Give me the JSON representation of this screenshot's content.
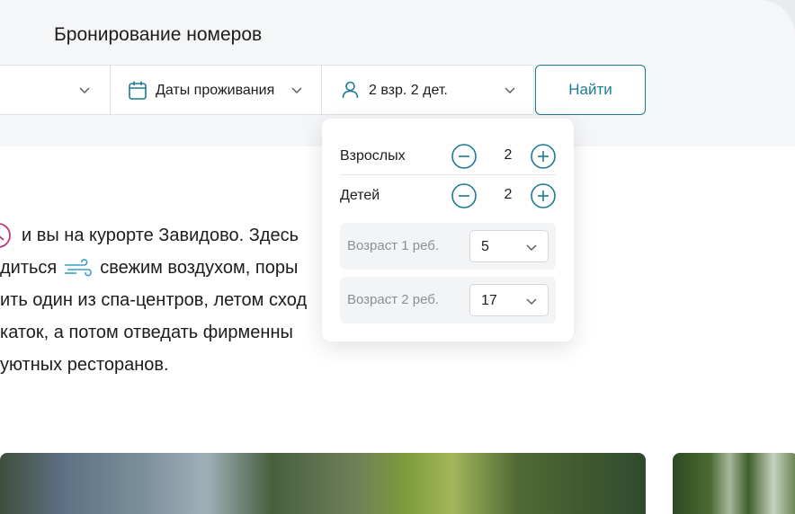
{
  "panel": {
    "title": "Бронирование номеров"
  },
  "search": {
    "dates_label": "Даты проживания",
    "guests_label": "2 взр. 2 дет.",
    "find_label": "Найти"
  },
  "guests_dropdown": {
    "adults": {
      "label": "Взрослых",
      "value": "2"
    },
    "children": {
      "label": "Детей",
      "value": "2"
    },
    "ages": [
      {
        "label": "Возраст 1 реб.",
        "value": "5"
      },
      {
        "label": "Возраст 2 реб.",
        "value": "17"
      }
    ]
  },
  "body_text": {
    "line1": "и вы на курорте Завидово. Здесь",
    "line2_a": "диться",
    "line2_b": "свежим воздухом, поры",
    "line3": "ить один из спа-центров, летом сход",
    "line4": "каток, а потом отведать фирменны",
    "line5": "уютных ресторанов."
  },
  "colors": {
    "accent": "#1d7a95",
    "clock_icon": "#c2357a",
    "wind_icon": "#3a9fc9"
  }
}
